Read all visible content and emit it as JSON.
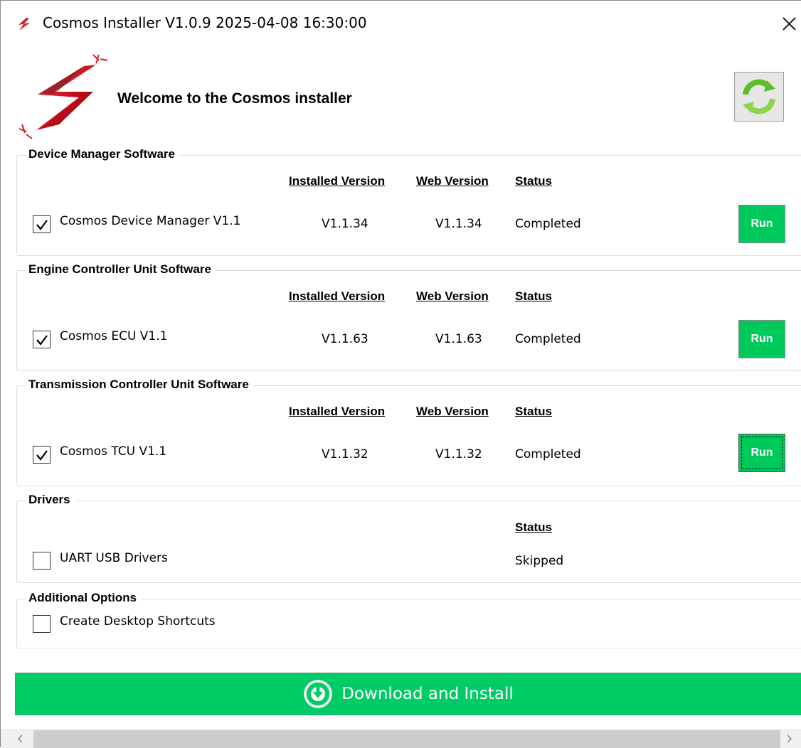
{
  "window": {
    "title": "Cosmos Installer V1.0.9 2025-04-08 16:30:00"
  },
  "header": {
    "welcome": "Welcome to the Cosmos installer"
  },
  "columns": {
    "installed": "Installed Version",
    "web": "Web Version",
    "status": "Status"
  },
  "groups": [
    {
      "title": "Device Manager Software",
      "item": {
        "label": "Cosmos Device Manager V1.1",
        "checked": true,
        "installed": "V1.1.34",
        "web": "V1.1.34",
        "status": "Completed",
        "action": "Run"
      }
    },
    {
      "title": "Engine Controller Unit Software",
      "item": {
        "label": "Cosmos ECU V1.1",
        "checked": true,
        "installed": "V1.1.63",
        "web": "V1.1.63",
        "status": "Completed",
        "action": "Run"
      }
    },
    {
      "title": "Transmission Controller Unit Software",
      "item": {
        "label": "Cosmos TCU V1.1",
        "checked": true,
        "installed": "V1.1.32",
        "web": "V1.1.32",
        "status": "Completed",
        "action": "Run"
      }
    }
  ],
  "drivers": {
    "title": "Drivers",
    "status_header": "Status",
    "item": {
      "label": "UART USB Drivers",
      "checked": false,
      "status": "Skipped"
    }
  },
  "additional": {
    "title": "Additional Options",
    "item": {
      "label": "Create Desktop Shortcuts",
      "checked": false
    }
  },
  "download": {
    "label": "Download and Install"
  },
  "colors": {
    "accent_green": "#00cc66",
    "run_green": "#00c95c",
    "logo_red": "#d8202a"
  },
  "icons": {
    "title": "lightning-icon",
    "close": "close-icon",
    "refresh": "refresh-icon",
    "download": "download-circle-icon",
    "logo": "cosmos-lightning-logo"
  }
}
